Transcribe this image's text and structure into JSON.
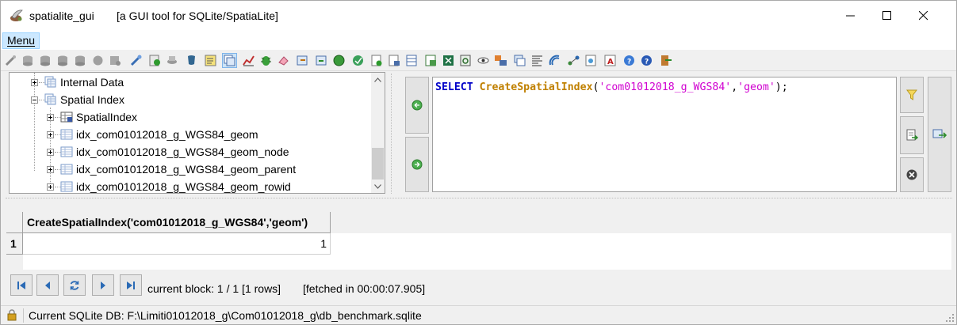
{
  "window": {
    "app_name": "spatialite_gui",
    "description": "[a GUI tool for SQLite/SpatiaLite]"
  },
  "menu": {
    "label": "Menu"
  },
  "tree": {
    "items": [
      {
        "label": "Internal Data",
        "icon": "folder-tables-icon"
      },
      {
        "label": "Spatial Index",
        "icon": "folder-tables-icon"
      },
      {
        "label": "SpatialIndex",
        "icon": "virtual-table-icon"
      },
      {
        "label": "idx_com01012018_g_WGS84_geom",
        "icon": "table-icon"
      },
      {
        "label": "idx_com01012018_g_WGS84_geom_node",
        "icon": "table-icon"
      },
      {
        "label": "idx_com01012018_g_WGS84_geom_parent",
        "icon": "table-icon"
      },
      {
        "label": "idx_com01012018_g_WGS84_geom_rowid",
        "icon": "table-icon"
      }
    ]
  },
  "sql": {
    "keyword": "SELECT",
    "function": "CreateSpatialIndex",
    "open_paren": "(",
    "arg1": "'com01012018_g_WGS84'",
    "comma": ",",
    "arg2": "'geom'",
    "close": ");"
  },
  "results": {
    "column_header": "CreateSpatialIndex('com01012018_g_WGS84','geom')",
    "rows": [
      {
        "row_number": "1",
        "value": "1"
      }
    ]
  },
  "navigation": {
    "block_info": "current block: 1 / 1 [1 rows]",
    "fetch_info": "[fetched in 00:00:07.905]"
  },
  "status": {
    "db_path": "Current SQLite DB: F:\\Limiti01012018_g\\Com01012018_g\\db_benchmark.sqlite"
  },
  "colors": {
    "sql_keyword": "#0000c8",
    "sql_function": "#c08000",
    "sql_string": "#d000d0",
    "menu_highlight": "#cce8ff"
  }
}
